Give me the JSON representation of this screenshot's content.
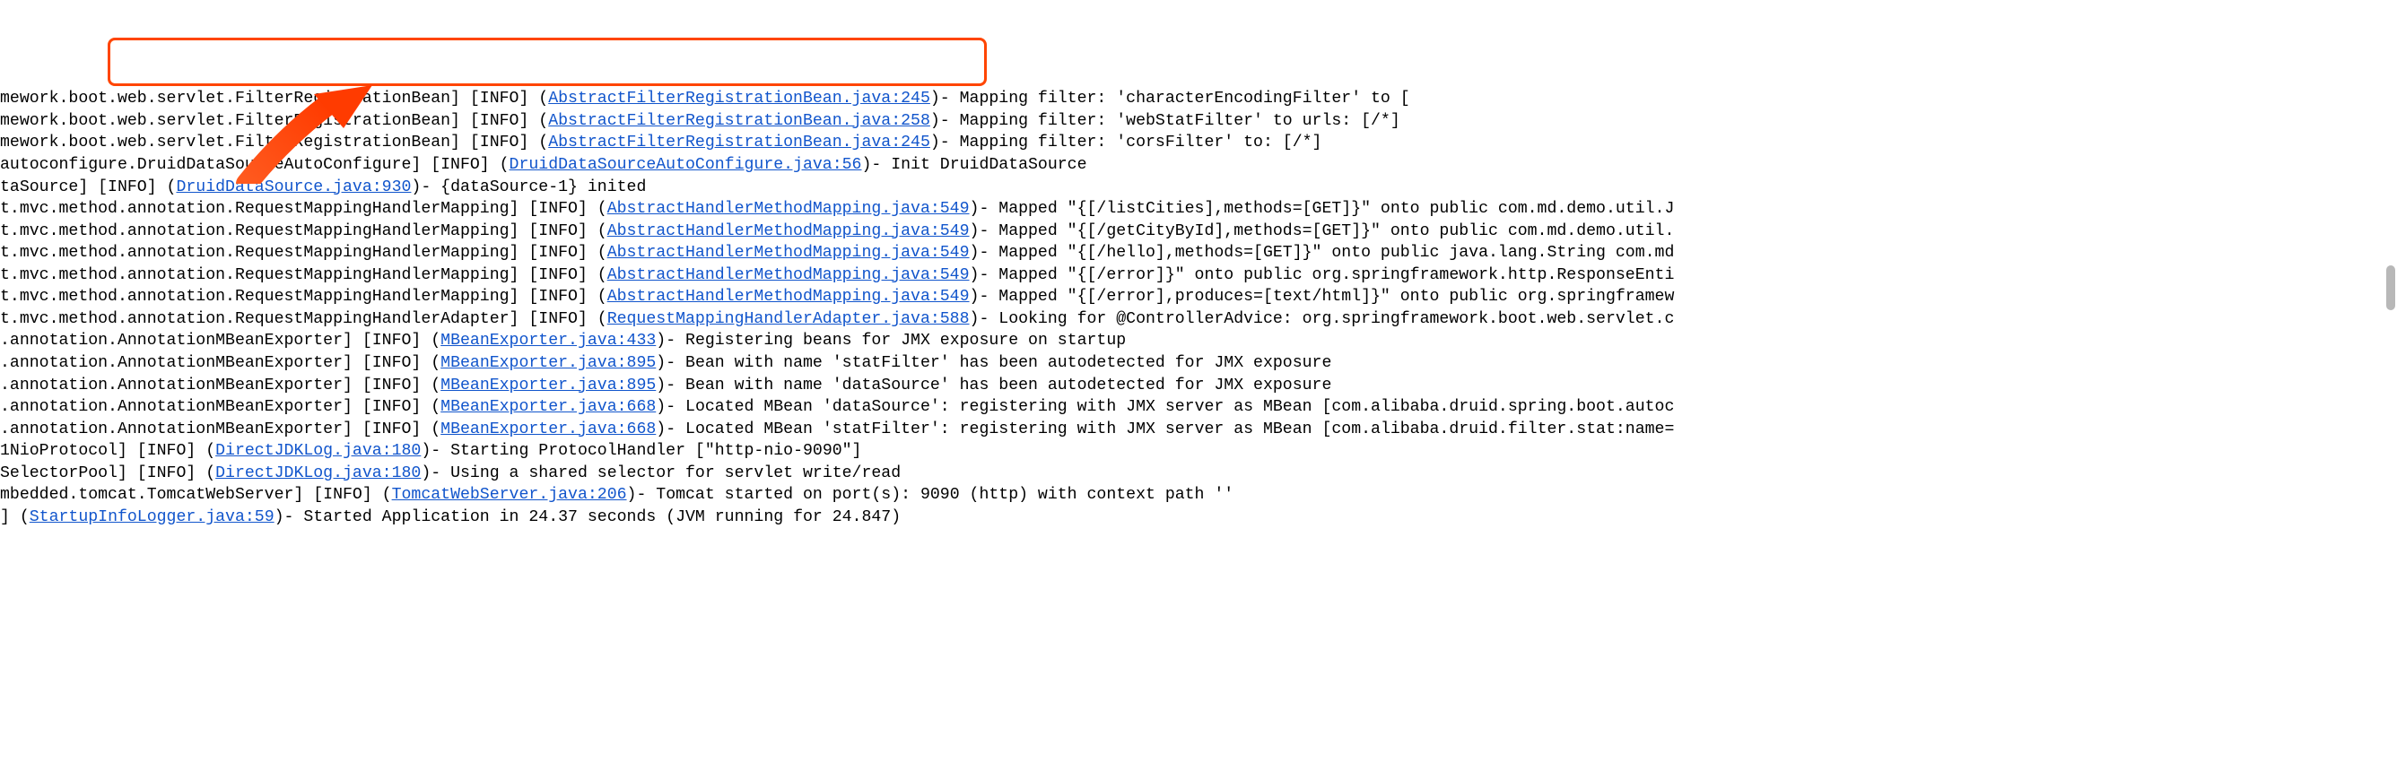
{
  "lines": [
    {
      "prefix": "mework.boot.web.servlet.FilterRegistrationBean] [INFO] (",
      "linkText": "AbstractFilterRegistrationBean.java:245",
      "suffix": ")- Mapping filter: 'characterEncodingFilter' to ["
    },
    {
      "prefix": "mework.boot.web.servlet.FilterRegistrationBean] [INFO] (",
      "linkText": "AbstractFilterRegistrationBean.java:258",
      "suffix": ")- Mapping filter: 'webStatFilter' to urls: [/*]"
    },
    {
      "prefix": "mework.boot.web.servlet.FilterRegistrationBean] [INFO] (",
      "linkText": "AbstractFilterRegistrationBean.java:245",
      "suffix": ")- Mapping filter: 'corsFilter' to: [/*]"
    },
    {
      "prefix": "autoconfigure.DruidDataSourceAutoConfigure] [INFO] (",
      "linkText": "DruidDataSourceAutoConfigure.java:56",
      "suffix": ")- Init DruidDataSource"
    },
    {
      "prefix": "taSource] [INFO] (",
      "linkText": "DruidDataSource.java:930",
      "suffix": ")- {dataSource-1} inited"
    },
    {
      "prefix": "t.mvc.method.annotation.RequestMappingHandlerMapping] [INFO] (",
      "linkText": "AbstractHandlerMethodMapping.java:549",
      "suffix": ")- Mapped \"{[/listCities],methods=[GET]}\" onto public com.md.demo.util.J"
    },
    {
      "prefix": "t.mvc.method.annotation.RequestMappingHandlerMapping] [INFO] (",
      "linkText": "AbstractHandlerMethodMapping.java:549",
      "suffix": ")- Mapped \"{[/getCityById],methods=[GET]}\" onto public com.md.demo.util."
    },
    {
      "prefix": "t.mvc.method.annotation.RequestMappingHandlerMapping] [INFO] (",
      "linkText": "AbstractHandlerMethodMapping.java:549",
      "suffix": ")- Mapped \"{[/hello],methods=[GET]}\" onto public java.lang.String com.md"
    },
    {
      "prefix": "t.mvc.method.annotation.RequestMappingHandlerMapping] [INFO] (",
      "linkText": "AbstractHandlerMethodMapping.java:549",
      "suffix": ")- Mapped \"{[/error]}\" onto public org.springframework.http.ResponseEnti"
    },
    {
      "prefix": "t.mvc.method.annotation.RequestMappingHandlerMapping] [INFO] (",
      "linkText": "AbstractHandlerMethodMapping.java:549",
      "suffix": ")- Mapped \"{[/error],produces=[text/html]}\" onto public org.springframew"
    },
    {
      "prefix": "t.mvc.method.annotation.RequestMappingHandlerAdapter] [INFO] (",
      "linkText": "RequestMappingHandlerAdapter.java:588",
      "suffix": ")- Looking for @ControllerAdvice: org.springframework.boot.web.servlet.c"
    },
    {
      "prefix": ".annotation.AnnotationMBeanExporter] [INFO] (",
      "linkText": "MBeanExporter.java:433",
      "suffix": ")- Registering beans for JMX exposure on startup"
    },
    {
      "prefix": ".annotation.AnnotationMBeanExporter] [INFO] (",
      "linkText": "MBeanExporter.java:895",
      "suffix": ")- Bean with name 'statFilter' has been autodetected for JMX exposure"
    },
    {
      "prefix": ".annotation.AnnotationMBeanExporter] [INFO] (",
      "linkText": "MBeanExporter.java:895",
      "suffix": ")- Bean with name 'dataSource' has been autodetected for JMX exposure"
    },
    {
      "prefix": ".annotation.AnnotationMBeanExporter] [INFO] (",
      "linkText": "MBeanExporter.java:668",
      "suffix": ")- Located MBean 'dataSource': registering with JMX server as MBean [com.alibaba.druid.spring.boot.autoc"
    },
    {
      "prefix": ".annotation.AnnotationMBeanExporter] [INFO] (",
      "linkText": "MBeanExporter.java:668",
      "suffix": ")- Located MBean 'statFilter': registering with JMX server as MBean [com.alibaba.druid.filter.stat:name="
    },
    {
      "prefix": "1NioProtocol] [INFO] (",
      "linkText": "DirectJDKLog.java:180",
      "suffix": ")- Starting ProtocolHandler [\"http-nio-9090\"]"
    },
    {
      "prefix": "SelectorPool] [INFO] (",
      "linkText": "DirectJDKLog.java:180",
      "suffix": ")- Using a shared selector for servlet write/read"
    },
    {
      "prefix": "mbedded.tomcat.TomcatWebServer] [INFO] (",
      "linkText": "TomcatWebServer.java:206",
      "suffix": ")- Tomcat started on port(s): 9090 (http) with context path ''"
    },
    {
      "prefix": "] (",
      "linkText": "StartupInfoLogger.java:59",
      "suffix": ")- Started Application in 24.37 seconds (JVM running for 24.847)"
    }
  ],
  "annotations": {
    "arrowColor": "#ff4500",
    "boxColor": "#ff4500"
  }
}
